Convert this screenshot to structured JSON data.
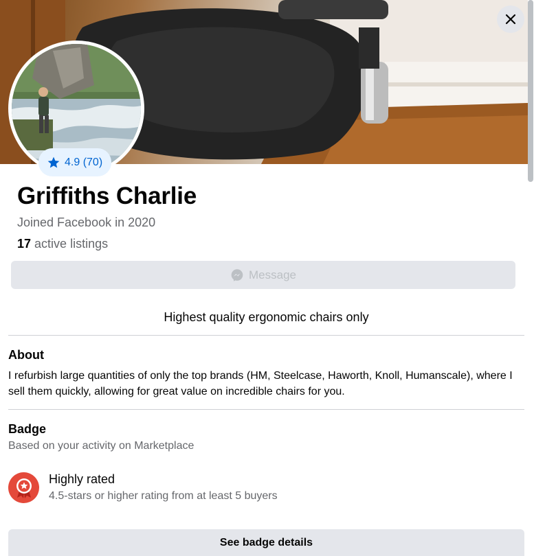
{
  "close_label": "Close",
  "profile": {
    "rating": "4.9 (70)",
    "name": "Griffiths Charlie",
    "joined": "Joined Facebook in 2020",
    "listings_count": "17",
    "listings_label": "active listings"
  },
  "message_button": {
    "label": "Message",
    "icon": "messenger-icon"
  },
  "tagline": "Highest quality ergonomic chairs only",
  "about": {
    "title": "About",
    "text": "I refurbish large quantities of only the top brands (HM, Steelcase, Haworth, Knoll, Humanscale), where I sell them quickly, allowing for great value on incredible chairs for you."
  },
  "badge": {
    "title": "Badge",
    "subtitle": "Based on your activity on Marketplace",
    "name": "Highly rated",
    "description": "4.5-stars or higher rating from at least 5 buyers",
    "icon": "highly-rated-badge-icon",
    "details_label": "See badge details"
  },
  "colors": {
    "accent": "#0064d1",
    "rating_bg": "#e7f3ff",
    "button_bg": "#e4e6eb",
    "badge_red": "#e4493a"
  }
}
